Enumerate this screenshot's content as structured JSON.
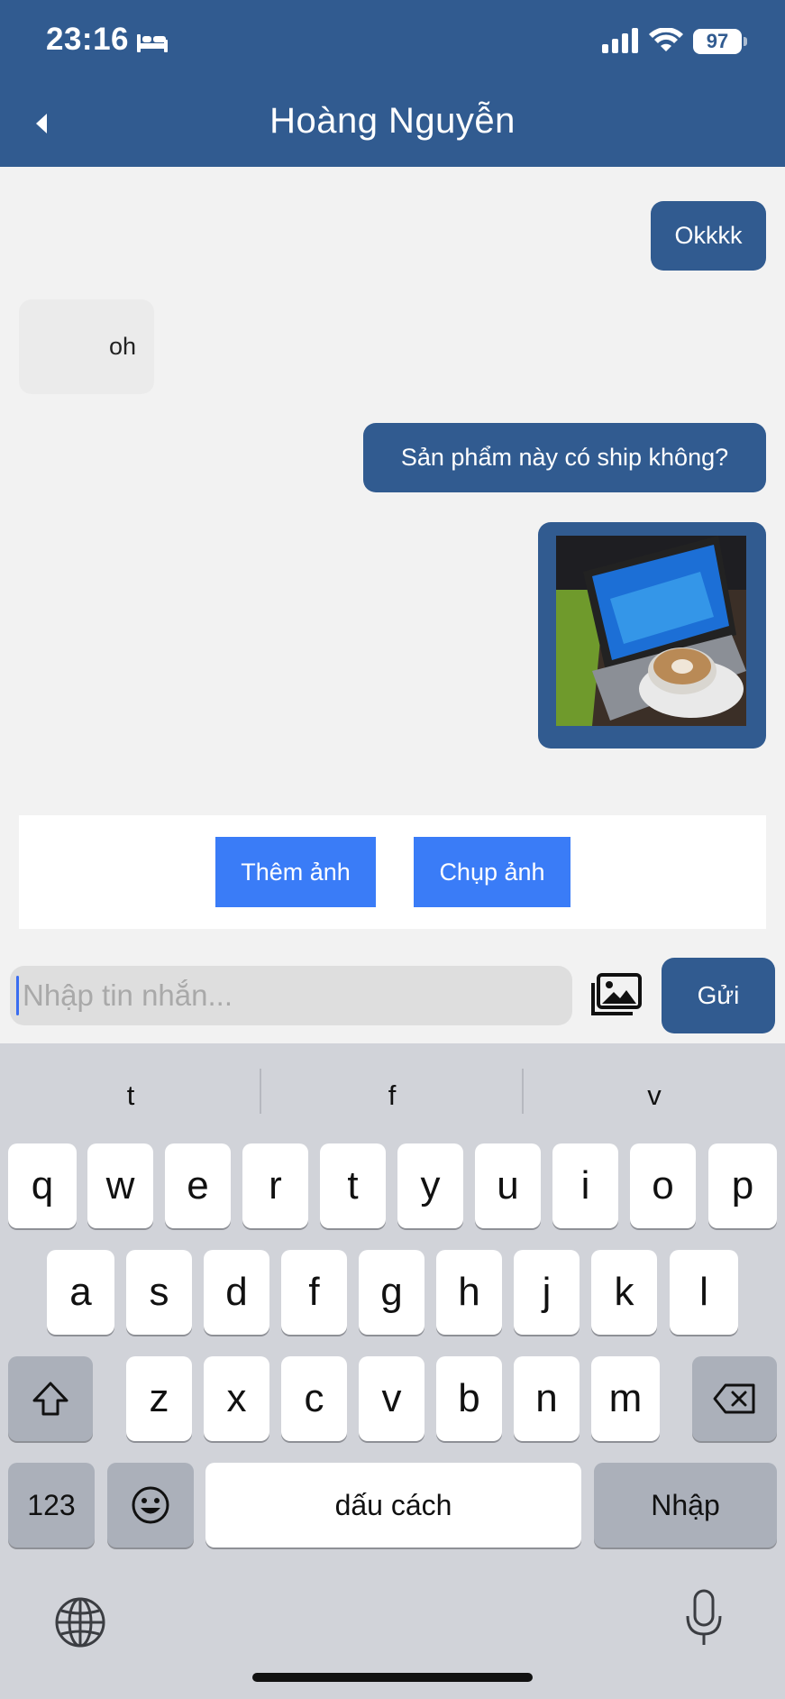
{
  "status_bar": {
    "time": "23:16",
    "battery": "97"
  },
  "header": {
    "title": "Hoàng  Nguyễn"
  },
  "messages": [
    {
      "direction": "out",
      "text": "Okkkk"
    },
    {
      "direction": "in",
      "text": "oh"
    },
    {
      "direction": "out",
      "text": "Sản phẩm này có ship không?"
    },
    {
      "direction": "out",
      "type": "image"
    }
  ],
  "actions": {
    "add_photo": "Thêm ảnh",
    "take_photo": "Chụp ảnh"
  },
  "composer": {
    "placeholder": "Nhập tin nhắn...",
    "send_label": "Gửi"
  },
  "keyboard": {
    "suggestions": [
      "t",
      "f",
      "v"
    ],
    "row1": [
      "q",
      "w",
      "e",
      "r",
      "t",
      "y",
      "u",
      "i",
      "o",
      "p"
    ],
    "row2": [
      "a",
      "s",
      "d",
      "f",
      "g",
      "h",
      "j",
      "k",
      "l"
    ],
    "row3": [
      "z",
      "x",
      "c",
      "v",
      "b",
      "n",
      "m"
    ],
    "numbers_label": "123",
    "space_label": "dấu cách",
    "return_label": "Nhập"
  },
  "colors": {
    "header": "#315b90",
    "action_button": "#3a7cf7",
    "bubble_out": "#315b90"
  }
}
